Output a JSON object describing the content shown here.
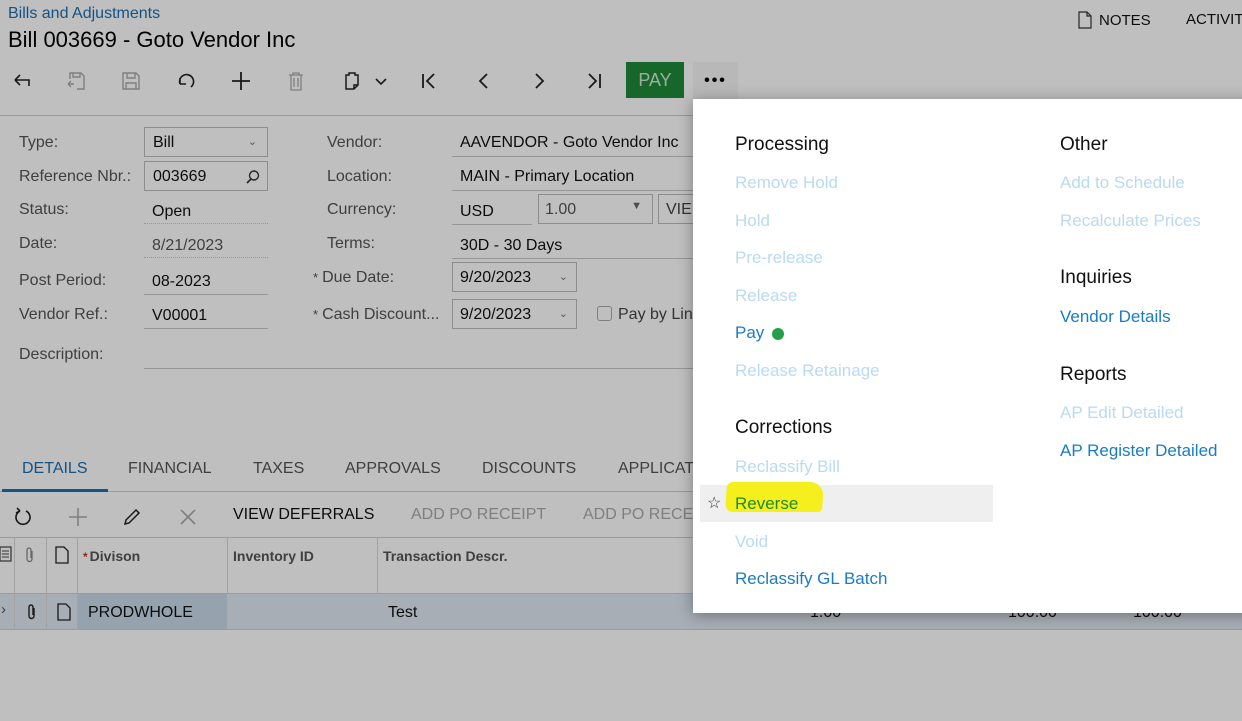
{
  "header": {
    "breadcrumb": "Bills and Adjustments",
    "title": "Bill 003669 - Goto Vendor Inc",
    "notes_label": "NOTES",
    "activities_label": "ACTIVIT"
  },
  "toolbar": {
    "buttons": [
      {
        "name": "back",
        "icon": "back-arrow-icon",
        "enabled": true
      },
      {
        "name": "save-and-close",
        "icon": "save-close-icon",
        "enabled": false
      },
      {
        "name": "save",
        "icon": "save-icon",
        "enabled": false
      },
      {
        "name": "cancel",
        "icon": "undo-icon",
        "enabled": true
      },
      {
        "name": "add",
        "icon": "plus-icon",
        "enabled": true
      },
      {
        "name": "delete",
        "icon": "trash-icon",
        "enabled": false
      },
      {
        "name": "copy-paste",
        "icon": "clipboard-icon",
        "enabled": true
      },
      {
        "name": "first",
        "icon": "first-record-icon",
        "enabled": true
      },
      {
        "name": "previous",
        "icon": "previous-icon",
        "enabled": true
      },
      {
        "name": "next",
        "icon": "next-icon",
        "enabled": true
      },
      {
        "name": "last",
        "icon": "last-record-icon",
        "enabled": true
      }
    ],
    "pay_label": "PAY",
    "more_label": "•••",
    "pay_color": "#1f8a3a"
  },
  "form": {
    "type_label": "Type:",
    "type_value": "Bill",
    "refnbr_label": "Reference Nbr.:",
    "refnbr_value": "003669",
    "status_label": "Status:",
    "status_value": "Open",
    "date_label": "Date:",
    "date_value": "8/21/2023",
    "postperiod_label": "Post Period:",
    "postperiod_value": "08-2023",
    "vendorref_label": "Vendor Ref.:",
    "vendorref_value": "V00001",
    "description_label": "Description:",
    "description_value": "",
    "vendor_label": "Vendor:",
    "vendor_value": "AAVENDOR - Goto Vendor Inc",
    "location_label": "Location:",
    "location_value": "MAIN - Primary Location",
    "currency_label": "Currency:",
    "currency_value": "USD",
    "rate_value": "1.00",
    "view_label": "VIE",
    "terms_label": "Terms:",
    "terms_value": "30D - 30 Days",
    "duedate_label": "Due Date:",
    "duedate_value": "9/20/2023",
    "cashdisc_label": "Cash Discount...",
    "cashdisc_value": "9/20/2023",
    "paybyline_label": "Pay by Lin",
    "paybyline_checked": false,
    "required_mark": "*"
  },
  "tabs": [
    {
      "label": "DETAILS",
      "active": true
    },
    {
      "label": "FINANCIAL",
      "active": false
    },
    {
      "label": "TAXES",
      "active": false
    },
    {
      "label": "APPROVALS",
      "active": false
    },
    {
      "label": "DISCOUNTS",
      "active": false
    },
    {
      "label": "APPLICAT",
      "active": false
    }
  ],
  "grid_toolbar": {
    "view_deferrals": "VIEW DEFERRALS",
    "add_po_receipt": "ADD PO RECEIPT",
    "add_po_receipt_line": "ADD PO RECE"
  },
  "grid": {
    "columns": [
      "Divison",
      "Inventory ID",
      "Transaction Descr."
    ],
    "required_mark": "*",
    "rows": [
      {
        "division": "PRODWHOLE",
        "inventory_id": "",
        "description": "Test",
        "qty": "1.00",
        "amount1": "100.00",
        "amount2": "100.00"
      }
    ]
  },
  "menu": {
    "processing": {
      "title": "Processing",
      "items": [
        {
          "label": "Remove Hold",
          "enabled": false
        },
        {
          "label": "Hold",
          "enabled": false
        },
        {
          "label": "Pre-release",
          "enabled": false
        },
        {
          "label": "Release",
          "enabled": false
        },
        {
          "label": "Pay",
          "enabled": true
        },
        {
          "label": "Release Retainage",
          "enabled": false
        }
      ]
    },
    "corrections": {
      "title": "Corrections",
      "items": [
        {
          "label": "Reclassify Bill",
          "enabled": false
        },
        {
          "label": "Reverse",
          "enabled": true
        },
        {
          "label": "Void",
          "enabled": false
        },
        {
          "label": "Reclassify GL Batch",
          "enabled": true
        }
      ]
    },
    "other": {
      "title": "Other",
      "items": [
        {
          "label": "Add to Schedule",
          "enabled": false
        },
        {
          "label": "Recalculate Prices",
          "enabled": false
        }
      ]
    },
    "inquiries": {
      "title": "Inquiries",
      "items": [
        {
          "label": "Vendor Details",
          "enabled": true
        }
      ]
    },
    "reports": {
      "title": "Reports",
      "items": [
        {
          "label": "AP Edit Detailed",
          "enabled": false
        },
        {
          "label": "AP Register Detailed",
          "enabled": true
        }
      ]
    },
    "highlight_color": "#f5ef1e",
    "pay_dot_color": "#23a047",
    "reverse_color": "#1f8a2e"
  }
}
